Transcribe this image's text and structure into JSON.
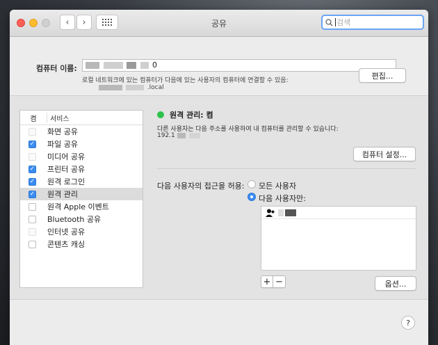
{
  "window": {
    "title": "공유",
    "search_placeholder": "검색"
  },
  "computer_name": {
    "label": "컴퓨터 이름:",
    "value_visible": "0",
    "info_line1": "로컬 네트워크에 있는 컴퓨터가 다음에 있는 사용자의 컴퓨터에 연결할 수 있음:",
    "info_line2_visible": ".local",
    "edit_button": "편집..."
  },
  "services": {
    "header_on": "켬",
    "header_service": "서비스",
    "items": [
      {
        "label": "화면 공유",
        "state": "disabled"
      },
      {
        "label": "파일 공유",
        "state": "on"
      },
      {
        "label": "미디어 공유",
        "state": "disabled"
      },
      {
        "label": "프린터 공유",
        "state": "on"
      },
      {
        "label": "원격 로그인",
        "state": "on"
      },
      {
        "label": "원격 관리",
        "state": "on",
        "selected": true
      },
      {
        "label": "원격 Apple 이벤트",
        "state": "off"
      },
      {
        "label": "Bluetooth 공유",
        "state": "off"
      },
      {
        "label": "인터넷 공유",
        "state": "disabled"
      },
      {
        "label": "콘텐츠 캐싱",
        "state": "off"
      }
    ]
  },
  "detail": {
    "status_title": "원격 관리: 켬",
    "status_color": "#2fc24b",
    "description": "다른 사용자는 다음 주소를 사용하여 내 컴퓨터를 관리할 수 있습니다:",
    "address_visible": "192.1",
    "computer_settings_button": "컴퓨터 설정...",
    "access_label": "다음 사용자의 접근을 허용:",
    "radio_all": "모든 사용자",
    "radio_only": "다음 사용자만:",
    "selected_radio": "radio_only",
    "add_button": "+",
    "remove_button": "−",
    "options_button": "옵션...",
    "user_name_visible": ""
  },
  "help_button": "?",
  "colors": {
    "accent": "#3b8cf0",
    "close": "#fe5f57",
    "minimize": "#febc2e",
    "zoom": "#cfcfcf"
  }
}
